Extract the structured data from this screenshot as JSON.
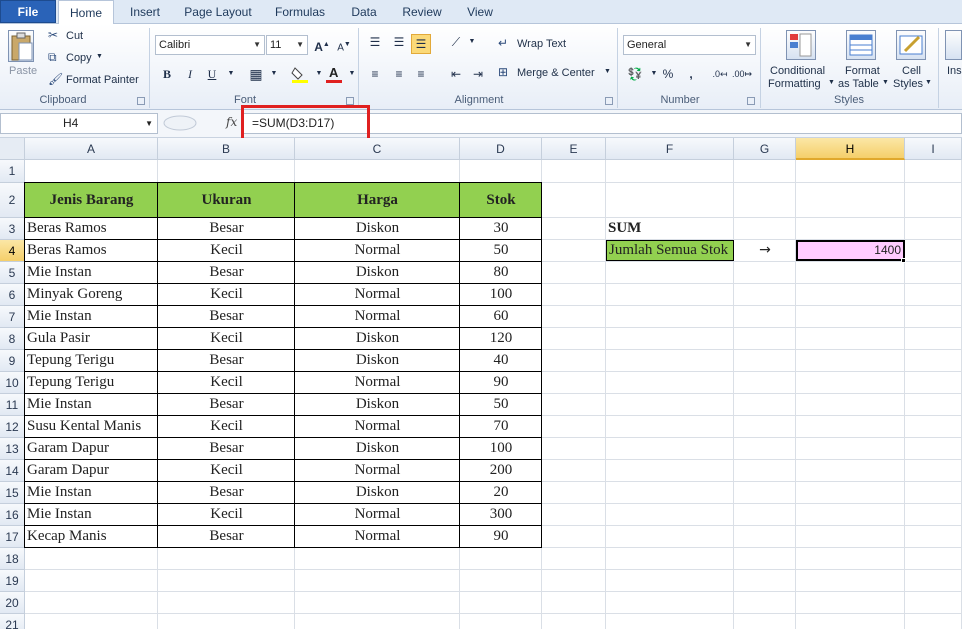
{
  "tabs": [
    "File",
    "Home",
    "Insert",
    "Page Layout",
    "Formulas",
    "Data",
    "Review",
    "View"
  ],
  "ribbon": {
    "clipboard": {
      "paste_label": "Paste",
      "cut_label": "Cut",
      "copy_label": "Copy",
      "format_painter_label": "Format Painter",
      "group_label": "Clipboard"
    },
    "font": {
      "font_name": "Calibri",
      "font_size": "11",
      "group_label": "Font",
      "bold": "B",
      "italic": "I",
      "underline": "U"
    },
    "alignment": {
      "wrap_text_label": "Wrap Text",
      "merge_center_label": "Merge & Center",
      "group_label": "Alignment"
    },
    "number": {
      "format": "General",
      "percent": "%",
      "comma": ",",
      "group_label": "Number"
    },
    "styles": {
      "conditional_line1": "Conditional",
      "conditional_line2": "Formatting",
      "format_table_line1": "Format",
      "format_table_line2": "as Table",
      "cell_styles_line1": "Cell",
      "cell_styles_line2": "Styles",
      "group_label": "Styles"
    },
    "cells": {
      "insert_partial": "Ins"
    }
  },
  "formula_bar": {
    "name_box": "H4",
    "fx": "fx",
    "formula": "=SUM(D3:D17)"
  },
  "columns": [
    "A",
    "B",
    "C",
    "D",
    "E",
    "F",
    "G",
    "H",
    "I"
  ],
  "rows": [
    "1",
    "2",
    "3",
    "4",
    "5",
    "6",
    "7",
    "8",
    "9",
    "10",
    "11",
    "12",
    "13",
    "14",
    "15",
    "16",
    "17",
    "18",
    "19",
    "20",
    "21"
  ],
  "selected_column": "H",
  "selected_row": "4",
  "table": {
    "headers": [
      "Jenis Barang",
      "Ukuran",
      "Harga",
      "Stok"
    ],
    "header_color": "#92d050",
    "rows": [
      [
        "Beras Ramos",
        "Besar",
        "Diskon",
        "30"
      ],
      [
        "Beras Ramos",
        "Kecil",
        "Normal",
        "50"
      ],
      [
        "Mie Instan",
        "Besar",
        "Diskon",
        "80"
      ],
      [
        "Minyak Goreng",
        "Kecil",
        "Normal",
        "100"
      ],
      [
        "Mie Instan",
        "Besar",
        "Normal",
        "60"
      ],
      [
        "Gula Pasir",
        "Kecil",
        "Diskon",
        "120"
      ],
      [
        "Tepung Terigu",
        "Besar",
        "Diskon",
        "40"
      ],
      [
        "Tepung Terigu",
        "Kecil",
        "Normal",
        "90"
      ],
      [
        "Mie Instan",
        "Besar",
        "Diskon",
        "50"
      ],
      [
        "Susu Kental Manis",
        "Kecil",
        "Normal",
        "70"
      ],
      [
        "Garam Dapur",
        "Besar",
        "Diskon",
        "100"
      ],
      [
        "Garam Dapur",
        "Kecil",
        "Normal",
        "200"
      ],
      [
        "Mie Instan",
        "Besar",
        "Diskon",
        "20"
      ],
      [
        "Mie Instan",
        "Kecil",
        "Normal",
        "300"
      ],
      [
        "Kecap Manis",
        "Besar",
        "Normal",
        "90"
      ]
    ]
  },
  "summary": {
    "title": "SUM",
    "label": "Jumlah Semua Stok",
    "label_color": "#92d050",
    "arrow": "→",
    "result": "1400",
    "result_color": "#ffccff"
  }
}
